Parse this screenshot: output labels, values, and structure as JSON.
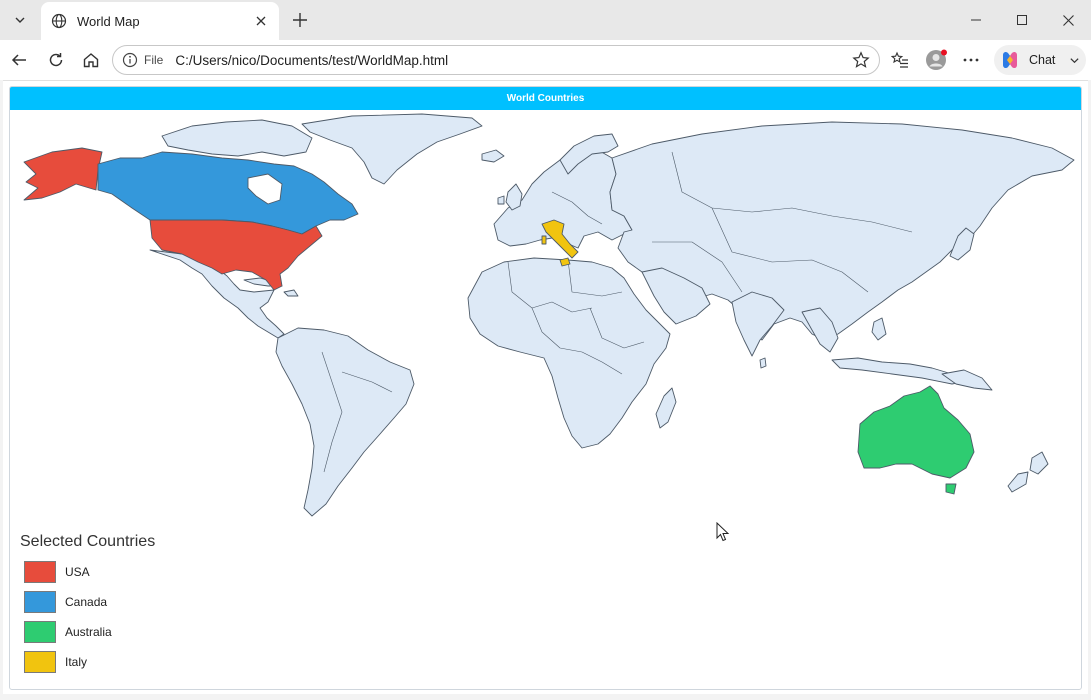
{
  "browser": {
    "tab": {
      "title": "World Map"
    },
    "address": {
      "scheme_label": "File",
      "url": "C:/Users/nico/Documents/test/WorldMap.html"
    },
    "chat_label": "Chat"
  },
  "map": {
    "title": "World Countries",
    "colors": {
      "default_fill": "#dde9f6",
      "stroke": "#4d5a68",
      "header": "#00c0ff"
    }
  },
  "legend": {
    "title": "Selected Countries",
    "items": [
      {
        "label": "USA",
        "color": "#e74c3c"
      },
      {
        "label": "Canada",
        "color": "#3498db"
      },
      {
        "label": "Australia",
        "color": "#2ecc71"
      },
      {
        "label": "Italy",
        "color": "#f1c40f"
      }
    ]
  }
}
